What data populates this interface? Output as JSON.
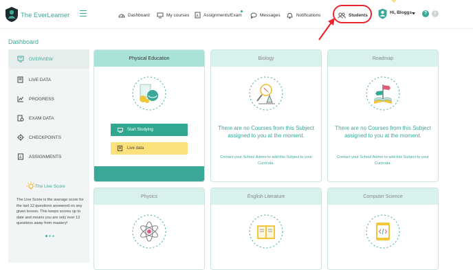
{
  "brand": {
    "name": "The EverLearner"
  },
  "nav": {
    "dashboard": "Dashboard",
    "courses": "My courses",
    "assignments": "Assignments/Exam",
    "messages": "Messages",
    "notifications": "Notifications",
    "students": "Students",
    "greeting": "Hi, Bloggs",
    "help": "?",
    "info": "i"
  },
  "page": {
    "title": "Dashboard"
  },
  "sidebar": {
    "items": [
      {
        "label": "OVERVIEW",
        "icon": "overview-icon",
        "active": true
      },
      {
        "label": "LIVE DATA",
        "icon": "live-data-icon"
      },
      {
        "label": "PROGRESS",
        "icon": "progress-icon"
      },
      {
        "label": "EXAM DATA",
        "icon": "exam-data-icon"
      },
      {
        "label": "CHECKPOINTS",
        "icon": "checkpoints-icon"
      },
      {
        "label": "ASSIGNMENTS",
        "icon": "assignments-icon"
      }
    ],
    "live_score": {
      "title": "The Live Score",
      "text": "The Live Score is the average score for the last 12 questions answered on any given lesson. This keeps scores up to date and means you are only ever 12 questions away from mastery!"
    }
  },
  "cards": [
    {
      "title": "Physical Education",
      "active": true,
      "start_label": "Start Studying",
      "live_label": "Live data"
    },
    {
      "title": "Biology",
      "message": "There are no Courses from this Subject assigned to you at the moment.",
      "contact": "Contact your School Admin to add this Subject to your Curricula."
    },
    {
      "title": "Roadmap",
      "message": "There are no Courses from this Subject assigned to you at the moment.",
      "contact": "Contact your School Admin to add this Subject to your Curricula."
    },
    {
      "title": "Physics"
    },
    {
      "title": "English Literature"
    },
    {
      "title": "Computer Science"
    }
  ],
  "colors": {
    "accent": "#3aa897",
    "highlight": "#e8262c",
    "live_button": "#fce07a"
  }
}
